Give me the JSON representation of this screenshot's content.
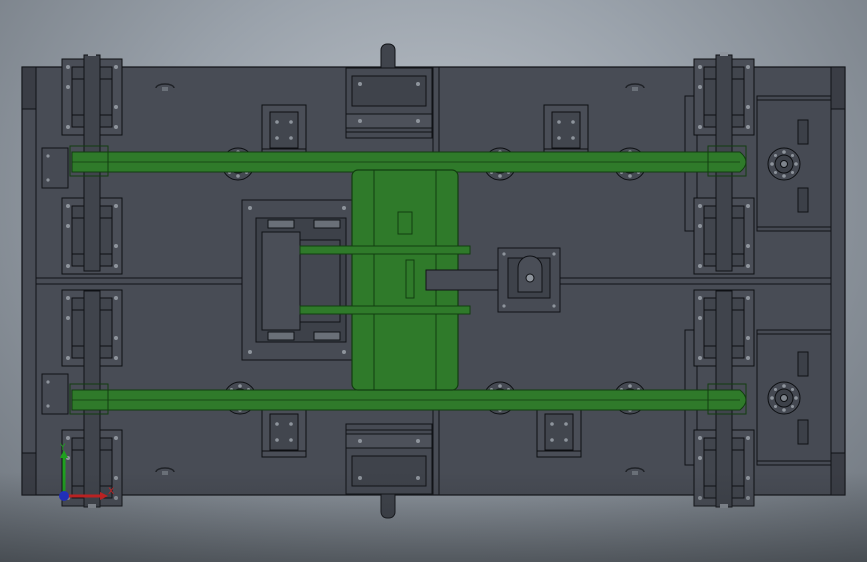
{
  "viewport": {
    "background_top": "#bcc2c9",
    "background_bottom": "#6f767e"
  },
  "model": {
    "frame_color": "#484c55",
    "edge_color": "#101216",
    "detail_color": "#5a5e68",
    "frame_dark": "#3a3d45",
    "hole_color": "#9aa0a8",
    "green_part_color": "#2f7a2a",
    "green_edge_color": "#123d10"
  },
  "triad": {
    "x_label": "X",
    "y_label": "Y",
    "x_color": "#d22020",
    "y_color": "#1fa01f",
    "z_color": "#2030d0"
  }
}
